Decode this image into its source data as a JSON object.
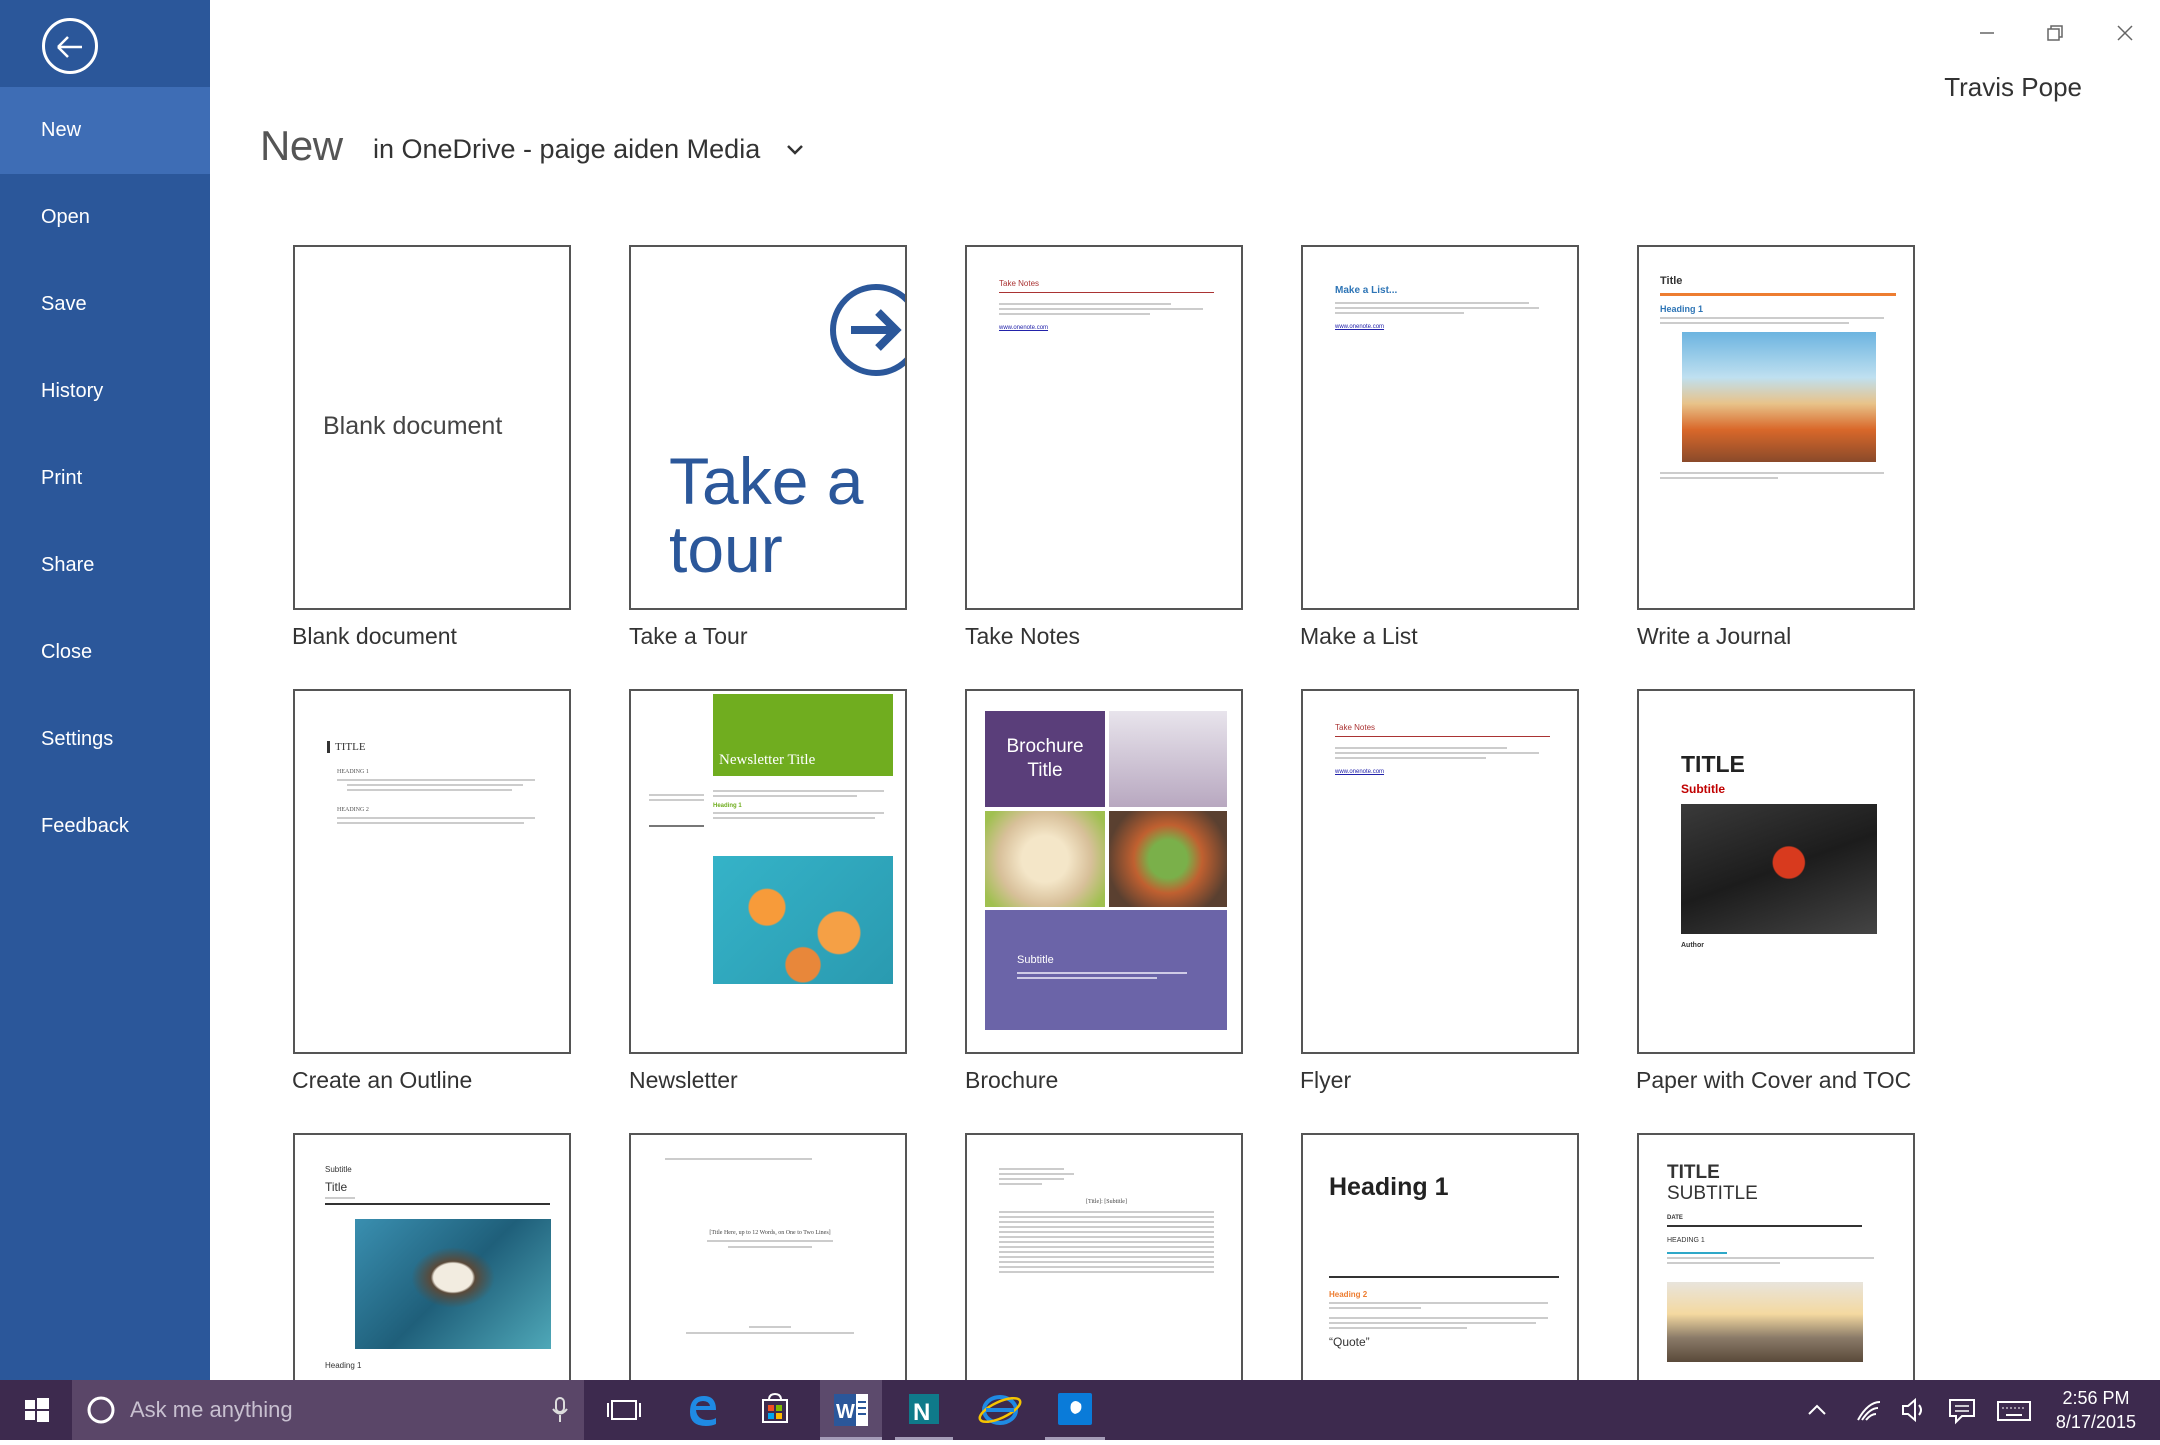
{
  "sidebar": {
    "items": [
      {
        "label": "New"
      },
      {
        "label": "Open"
      },
      {
        "label": "Save"
      },
      {
        "label": "History"
      },
      {
        "label": "Print"
      },
      {
        "label": "Share"
      },
      {
        "label": "Close"
      },
      {
        "label": "Settings"
      },
      {
        "label": "Feedback"
      }
    ]
  },
  "header": {
    "title": "New",
    "location": "in OneDrive - paige aiden Media",
    "user": "Travis Pope"
  },
  "templates": [
    {
      "label": "Blank document",
      "preview_text": "Blank document"
    },
    {
      "label": "Take a Tour",
      "preview_text": "Take a tour"
    },
    {
      "label": "Take Notes",
      "preview_heading": "Take Notes",
      "preview_link": "www.onenote.com"
    },
    {
      "label": "Make a List",
      "preview_heading": "Make a List...",
      "preview_link": "www.onenote.com"
    },
    {
      "label": "Write a Journal",
      "preview_heading": "Title",
      "preview_sub": "Heading 1"
    },
    {
      "label": "Create an Outline",
      "preview_heading": "TITLE",
      "preview_sub1": "HEADING 1",
      "preview_sub2": "HEADING 2"
    },
    {
      "label": "Newsletter",
      "preview_heading": "Newsletter Title",
      "preview_sub": "Heading 1"
    },
    {
      "label": "Brochure",
      "preview_heading": "Brochure Title",
      "preview_sub": "Subtitle"
    },
    {
      "label": "Flyer",
      "preview_heading": "Take Notes",
      "preview_link": "www.onenote.com"
    },
    {
      "label": "Paper with Cover and TOC",
      "preview_heading": "TITLE",
      "preview_sub": "Subtitle",
      "preview_author": "Author"
    },
    {
      "preview_sub": "Subtitle",
      "preview_heading": "Title",
      "preview_foot": "Heading 1"
    },
    {
      "preview_heading": "[Title Here, up to 12 Words, on One to Two Lines]"
    },
    {
      "preview_heading": "[Title]: [Subtitle]"
    },
    {
      "preview_heading": "Heading 1",
      "preview_sub": "Heading 2",
      "preview_quote": "“Quote”"
    },
    {
      "preview_heading": "TITLE",
      "preview_sub": "SUBTITLE",
      "preview_date": "DATE",
      "preview_h1": "HEADING 1"
    }
  ],
  "taskbar": {
    "search_placeholder": "Ask me anything",
    "time": "2:56 PM",
    "date": "8/17/2015"
  },
  "colors": {
    "sidebar": "#2b579a",
    "sidebar_active": "#3e6db5",
    "taskbar": "#3d2a4e",
    "tour_blue": "#2b579a",
    "journal_orange": "#ed7d31",
    "newsletter_green": "#70ad1f",
    "brochure_purple": "#5a3e7a",
    "paper_red": "#c00000"
  }
}
